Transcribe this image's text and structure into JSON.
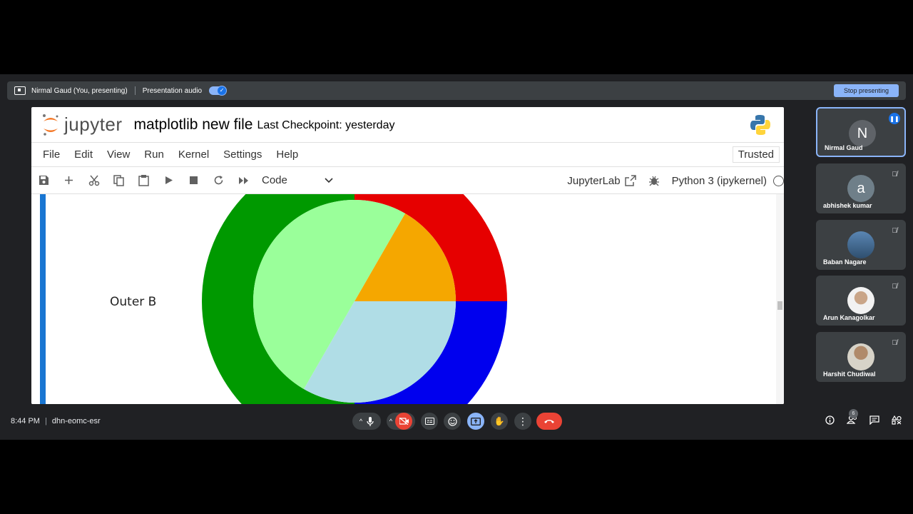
{
  "present_bar": {
    "presenter": "Nirmal Gaud (You, presenting)",
    "audio_label": "Presentation audio",
    "stop_label": "Stop presenting"
  },
  "jupyter": {
    "logo_word": "jupyter",
    "notebook_title": "matplotlib new file",
    "checkpoint": "Last Checkpoint: yesterday",
    "menu": [
      "File",
      "Edit",
      "View",
      "Run",
      "Kernel",
      "Settings",
      "Help"
    ],
    "trusted": "Trusted",
    "cell_type": "Code",
    "jupyterlab_label": "JupyterLab",
    "kernel_name": "Python 3 (ipykernel)"
  },
  "chart_data": {
    "type": "pie",
    "label": "Outer B",
    "outer_ring": [
      {
        "color": "#e60000",
        "start_deg": 0,
        "end_deg": 90
      },
      {
        "color": "#0000ee",
        "start_deg": -90,
        "end_deg": 0
      },
      {
        "color": "#009900",
        "start_deg": 90,
        "end_deg": 270
      }
    ],
    "inner_pie": [
      {
        "color": "#f5a700",
        "start_deg": 0,
        "end_deg": 60
      },
      {
        "color": "#9aff9a",
        "start_deg": 60,
        "end_deg": 240
      },
      {
        "color": "#b0dde6",
        "start_deg": 240,
        "end_deg": 360
      }
    ]
  },
  "participants": [
    {
      "name": "Nirmal Gaud",
      "initial": "N",
      "color": "#5f6368",
      "active": true
    },
    {
      "name": "abhishek kumar",
      "initial": "a",
      "color": "#6f7f89",
      "active": false
    },
    {
      "name": "Baban Nagare",
      "initial": "",
      "color": "#4a6c8f",
      "active": false
    },
    {
      "name": "Arun Kanagolkar",
      "initial": "",
      "color": "#c9b8a6",
      "active": false
    },
    {
      "name": "Harshit Chudiwal",
      "initial": "",
      "color": "#8a7a6a",
      "active": false
    }
  ],
  "bottom": {
    "time": "8:44 PM",
    "meeting_code": "dhn-eomc-esr",
    "participant_count": "6"
  }
}
